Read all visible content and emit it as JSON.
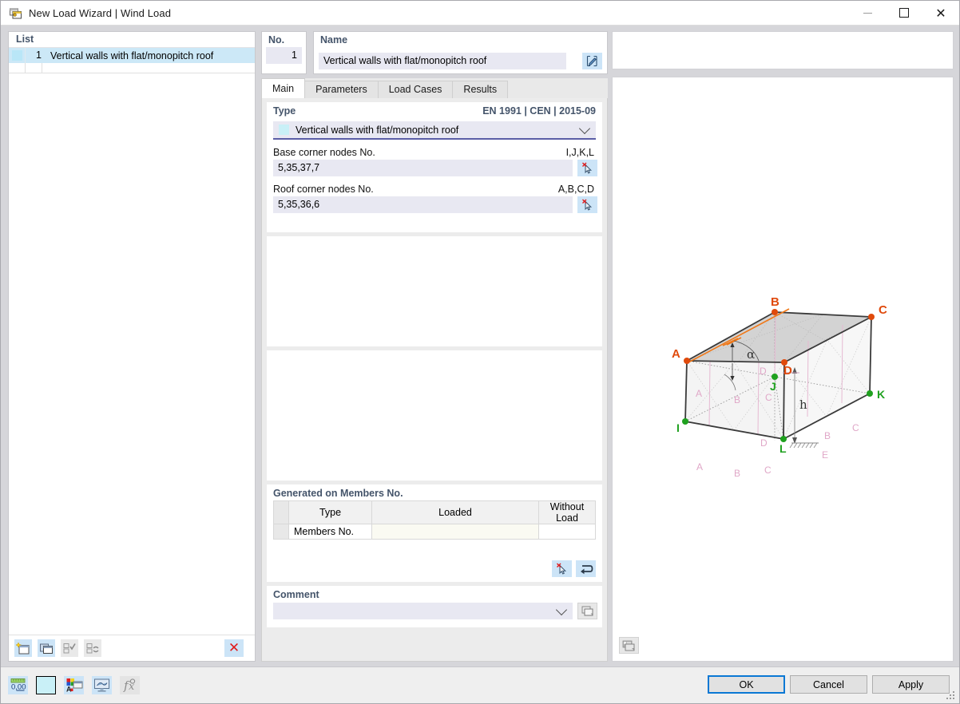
{
  "window": {
    "title": "New Load Wizard | Wind Load",
    "icon": "wizard-window-icon",
    "minimize": "minimize-icon",
    "maximize": "maximize-icon",
    "close": "close-icon"
  },
  "left_panel": {
    "header": "List",
    "rows": [
      {
        "no": "1",
        "name": "Vertical walls with flat/monopitch roof",
        "color": "#b9e6f7"
      }
    ],
    "toolbar": [
      {
        "name": "new-item-button",
        "enabled": true
      },
      {
        "name": "copy-item-button",
        "enabled": true
      },
      {
        "name": "select-all-button",
        "enabled": false
      },
      {
        "name": "invert-selection-button",
        "enabled": false
      },
      {
        "name": "delete-item-button",
        "enabled": true,
        "glyph": "✕"
      }
    ]
  },
  "header": {
    "no_label": "No.",
    "no_value": "1",
    "name_label": "Name",
    "name_value": "Vertical walls with flat/monopitch roof",
    "edit_button": "edit-name-button"
  },
  "tabs": [
    {
      "label": "Main",
      "active": true
    },
    {
      "label": "Parameters",
      "active": false
    },
    {
      "label": "Load Cases",
      "active": false
    },
    {
      "label": "Results",
      "active": false
    }
  ],
  "main": {
    "type_card": {
      "title": "Type",
      "standard": "EN 1991 | CEN | 2015-09",
      "selected_type": "Vertical walls with flat/monopitch roof",
      "base_nodes_label": "Base corner nodes No.",
      "base_nodes_hint": "I,J,K,L",
      "base_nodes_value": "5,35,37,7",
      "roof_nodes_label": "Roof corner nodes No.",
      "roof_nodes_hint": "A,B,C,D",
      "roof_nodes_value": "5,35,36,6",
      "pick_button": "pick-nodes-button"
    },
    "generated": {
      "title": "Generated on Members No.",
      "columns": [
        "",
        "Type",
        "Loaded",
        "Without Load"
      ],
      "rows": [
        {
          "type": "Members No.",
          "loaded": "",
          "without_load": ""
        }
      ],
      "pick_button": "pick-members-button",
      "reset_button": "reset-members-button"
    },
    "comment": {
      "title": "Comment",
      "value": "",
      "dropdown": "comment-dropdown-chevron",
      "library_button": "comment-library-button"
    }
  },
  "preview": {
    "settings_button": "preview-settings-button",
    "diagram": {
      "roof_nodes": [
        "A",
        "B",
        "C",
        "D"
      ],
      "base_nodes": [
        "I",
        "J",
        "K",
        "L"
      ],
      "angle_label": "α",
      "height_label": "h",
      "zone_labels_left": [
        "A",
        "B",
        "C",
        "D"
      ],
      "zone_labels_right": [
        "B",
        "C",
        "E"
      ],
      "roof_node_color": "#e04a0c",
      "base_node_color": "#1fa11f",
      "zone_label_color": "#e0a8c8",
      "ridge_color": "#f07818"
    }
  },
  "bottom_toolbar": [
    {
      "name": "units-button",
      "label": "0,00",
      "enabled": true
    },
    {
      "name": "color-swatch-button",
      "color": "#c9f0f7",
      "enabled": true
    },
    {
      "name": "display-properties-button",
      "enabled": true
    },
    {
      "name": "graphic-view-button",
      "enabled": true
    },
    {
      "name": "formula-button",
      "enabled": false
    }
  ],
  "dialog_buttons": {
    "ok": "OK",
    "cancel": "Cancel",
    "apply": "Apply"
  }
}
